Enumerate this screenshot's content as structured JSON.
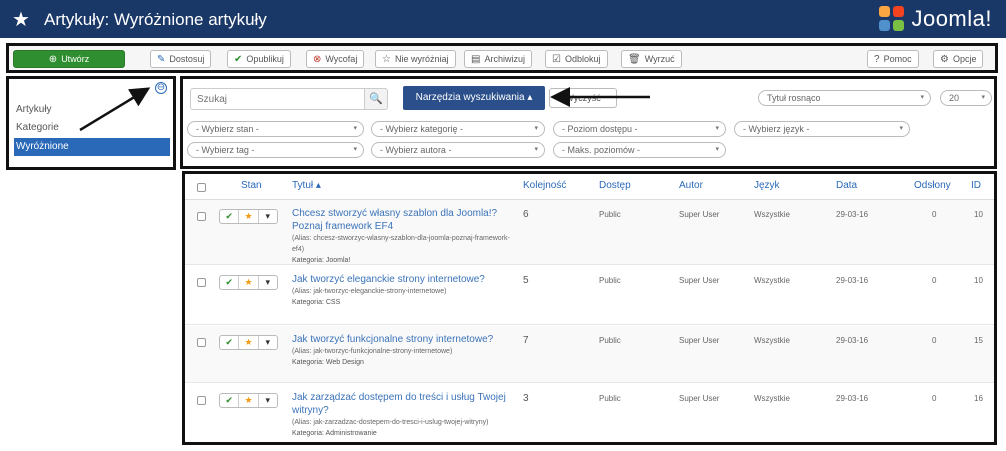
{
  "header": {
    "title": "Artykuły: Wyróżnione artykuły",
    "star_icon": "star-icon",
    "logo_text": "Joomla!"
  },
  "toolbar": {
    "new": "Utwórz",
    "edit": "Dostosuj",
    "publish": "Opublikuj",
    "unpublish": "Wycofaj",
    "unfeature": "Nie wyróżniaj",
    "archive": "Archiwizuj",
    "checkin": "Odblokuj",
    "trash": "Wyrzuć",
    "help": "Pomoc",
    "options": "Opcje"
  },
  "sidebar": {
    "items": [
      {
        "label": "Artykuły",
        "active": false
      },
      {
        "label": "Kategorie",
        "active": false
      },
      {
        "label": "Wyróżnione",
        "active": true
      }
    ]
  },
  "search": {
    "placeholder": "Szukaj",
    "tools_label": "Narzędzia wyszukiwania ▴",
    "clear_label": "Wyczyść",
    "sort_value": "Tytuł rosnąco",
    "limit_value": "20"
  },
  "filters": {
    "state": "- Wybierz stan -",
    "category": "- Wybierz kategorię -",
    "access": "- Poziom dostępu -",
    "language": "- Wybierz język -",
    "tag": "- Wybierz tag -",
    "author": "- Wybierz autora -",
    "levels": "- Maks. poziomów -"
  },
  "table": {
    "headers": {
      "status": "Stan",
      "title": "Tytuł ▴",
      "ordering": "Kolejność",
      "access": "Dostęp",
      "author": "Autor",
      "language": "Język",
      "date": "Data",
      "hits": "Odsłony",
      "id": "ID"
    },
    "rows": [
      {
        "title": "Chcesz stworzyć własny szablon dla Joomla!? Poznaj framework EF4",
        "alias": "(Alias: chcesz-stworzyc-wlasny-szablon-dla-joomla-poznaj-framework-ef4)",
        "category": "Kategoria: Joomla!",
        "ordering": "6",
        "access": "Public",
        "author": "Super User",
        "language": "Wszystkie",
        "date": "29-03-16",
        "hits": "0",
        "id": "10"
      },
      {
        "title": "Jak tworzyć eleganckie strony internetowe?",
        "alias": "(Alias: jak-tworzyc-eleganckie-strony-internetowe)",
        "category": "Kategoria: CSS",
        "ordering": "5",
        "access": "Public",
        "author": "Super User",
        "language": "Wszystkie",
        "date": "29-03-16",
        "hits": "0",
        "id": "10"
      },
      {
        "title": "Jak tworzyć funkcjonalne strony internetowe?",
        "alias": "(Alias: jak-tworzyc-funkcjonalne-strony-internetowe)",
        "category": "Kategoria: Web Design",
        "ordering": "7",
        "access": "Public",
        "author": "Super User",
        "language": "Wszystkie",
        "date": "29-03-16",
        "hits": "0",
        "id": "15"
      },
      {
        "title": "Jak zarządzać dostępem do treści i usług Twojej witryny?",
        "alias": "(Alias: jak-zarzadzac-dostepem-do-tresci-i-uslug-twojej-witryny)",
        "category": "Kategoria: Administrowanie",
        "ordering": "3",
        "access": "Public",
        "author": "Super User",
        "language": "Wszystkie",
        "date": "29-03-16",
        "hits": "0",
        "id": "16"
      }
    ]
  },
  "colors": {
    "header_bg": "#1a3867",
    "primary_button": "#2f8e2f",
    "link_blue": "#3b73b9",
    "active_sidebar": "#2a69b8"
  }
}
